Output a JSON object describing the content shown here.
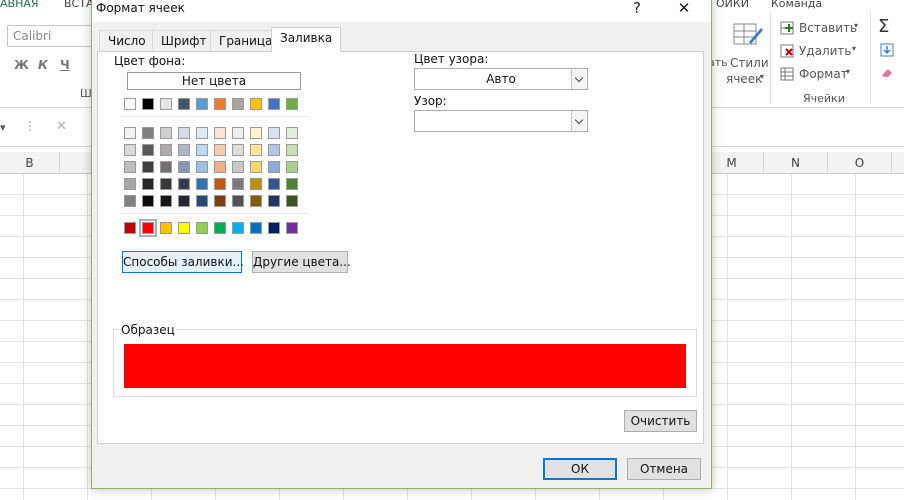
{
  "ribbon": {
    "tabs": [
      "АВНАЯ",
      "ВСТА",
      "ОЙКИ",
      "Команда"
    ],
    "font_name": "Calibri",
    "format_buttons": [
      "Ж",
      "К",
      "Ч"
    ],
    "group_label_font": "Ш",
    "conditional_partial": "ать",
    "styles_label_1": "Стили",
    "styles_label_2": "ячеек",
    "insert_label": "Вставить",
    "delete_label": "Удалить",
    "format_label": "Формат",
    "cells_group_label": "Ячейки",
    "sigma": "Σ"
  },
  "formula_bar": {
    "cancel": "✕",
    "dots": "⋮"
  },
  "columns": [
    "В",
    "M",
    "N",
    "O"
  ],
  "dialog": {
    "title": "Формат ячеек",
    "help": "?",
    "close": "✕",
    "tabs": [
      "Число",
      "Шрифт",
      "Граница",
      "Заливка"
    ],
    "active_tab": "Заливка",
    "bg_color_label": "Цвет фона:",
    "no_color_label": "Нет цвета",
    "pattern_color_label": "Цвет узора:",
    "pattern_color_value": "Авто",
    "pattern_label": "Узор:",
    "pattern_value": "",
    "fill_effects_label": "Способы заливки...",
    "more_colors_label": "Другие цвета...",
    "sample_label": "Образец",
    "sample_color": "#FF0000",
    "clear_label": "Очистить",
    "ok_label": "ОК",
    "cancel_label": "Отмена",
    "theme_top": [
      "#FFFFFF",
      "#000000",
      "#E7E6E6",
      "#44546A",
      "#5B9BD5",
      "#ED7D31",
      "#A5A5A5",
      "#FFC000",
      "#4472C4",
      "#70AD47"
    ],
    "theme_tints": [
      [
        "#F2F2F2",
        "#7F7F7F",
        "#D0CECE",
        "#D6DCE4",
        "#DDEBF7",
        "#FCE4D6",
        "#EDEDED",
        "#FFF2CC",
        "#D9E1F2",
        "#E2EFDA"
      ],
      [
        "#D9D9D9",
        "#595959",
        "#AEAAAA",
        "#ADB9CA",
        "#BDD7EE",
        "#F8CBAD",
        "#DBDBDB",
        "#FFE699",
        "#B4C6E7",
        "#C6E0B4"
      ],
      [
        "#BFBFBF",
        "#404040",
        "#757171",
        "#8497B0",
        "#9BC2E6",
        "#F4B084",
        "#C9C9C9",
        "#FFD966",
        "#8EA9DB",
        "#A9D08E"
      ],
      [
        "#A6A6A6",
        "#262626",
        "#3A3838",
        "#333F4F",
        "#2F75B5",
        "#C65911",
        "#7B7B7B",
        "#BF8F00",
        "#305496",
        "#548235"
      ],
      [
        "#808080",
        "#0D0D0D",
        "#161616",
        "#222B35",
        "#1F4E78",
        "#833C0C",
        "#525252",
        "#806000",
        "#203764",
        "#375623"
      ]
    ],
    "standard_colors": [
      "#C00000",
      "#FF0000",
      "#FFC000",
      "#FFFF00",
      "#92D050",
      "#00B050",
      "#00B0F0",
      "#0070C0",
      "#002060",
      "#7030A0"
    ],
    "selected_standard_index": 1
  }
}
